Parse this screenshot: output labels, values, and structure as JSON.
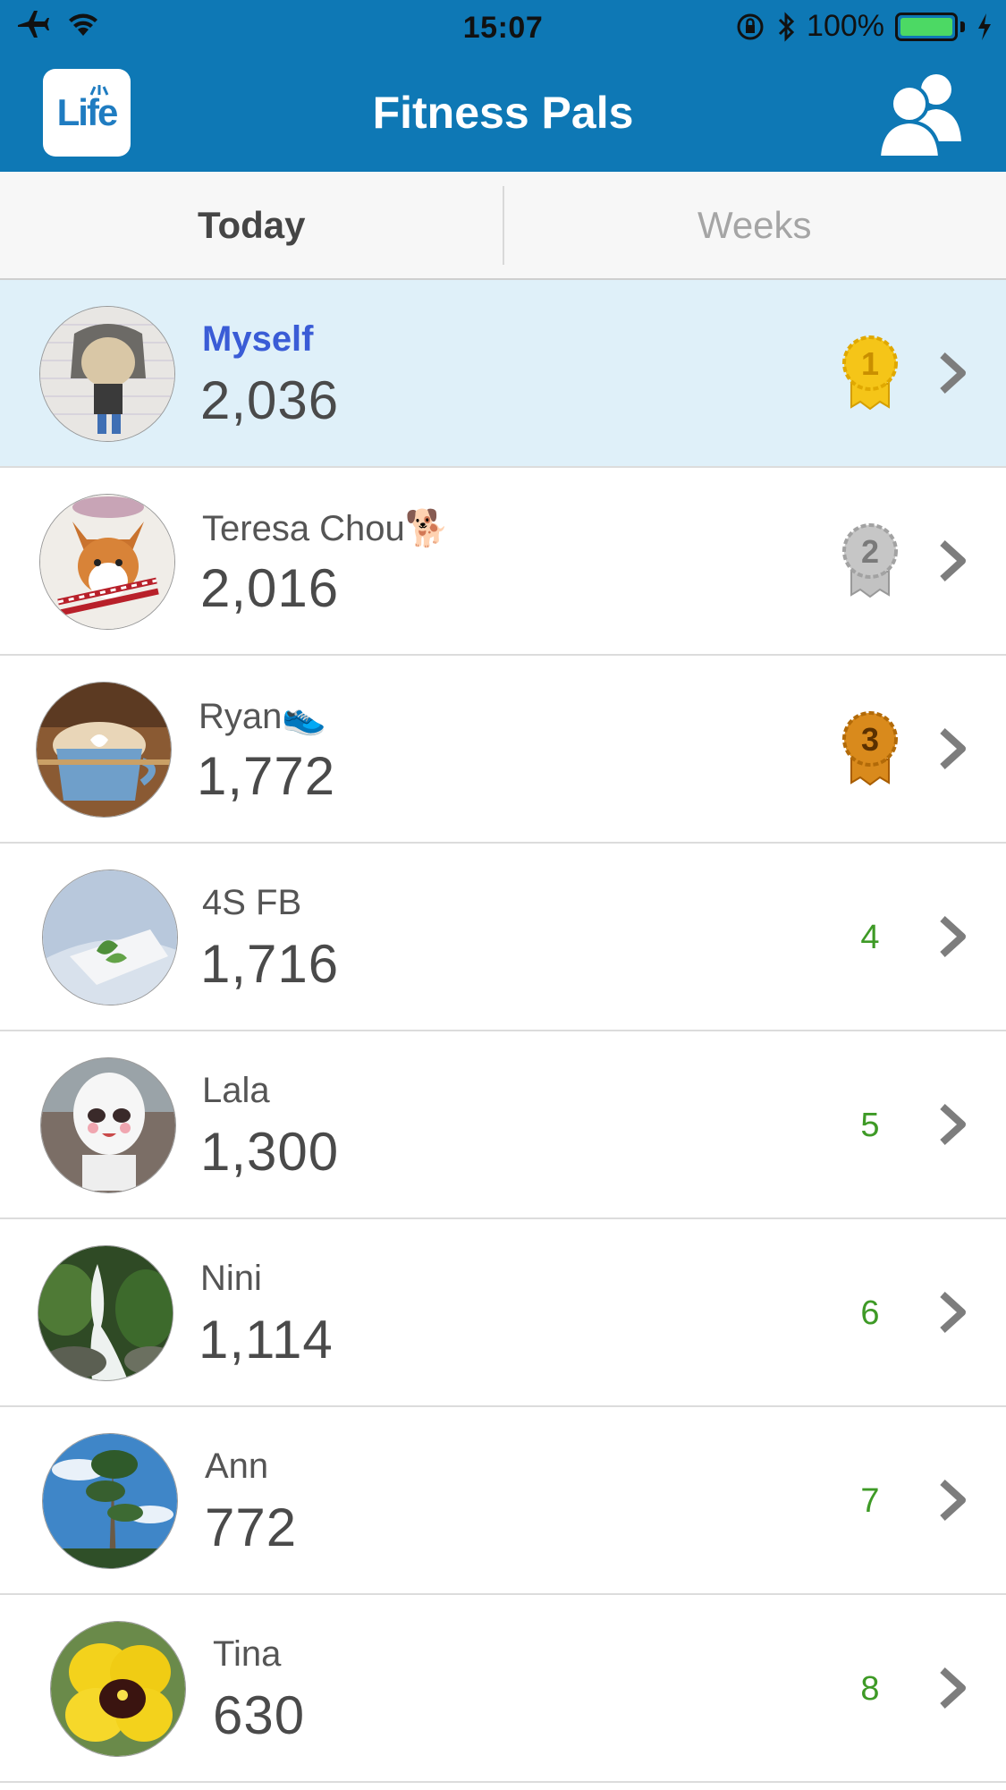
{
  "status_bar": {
    "time": "15:07",
    "battery": "100%"
  },
  "nav": {
    "logo_text": "Life",
    "title": "Fitness Pals"
  },
  "tabs": [
    {
      "label": "Today",
      "active": true
    },
    {
      "label": "Weeks",
      "active": false
    }
  ],
  "pals": [
    {
      "name": "Myself",
      "steps": "2,036",
      "rank": "1",
      "medal": "gold"
    },
    {
      "name": "Teresa Chou🐕",
      "steps": "2,016",
      "rank": "2",
      "medal": "silver"
    },
    {
      "name": "Ryan👟",
      "steps": "1,772",
      "rank": "3",
      "medal": "bronze"
    },
    {
      "name": "4S FB",
      "steps": "1,716",
      "rank": "4"
    },
    {
      "name": "Lala",
      "steps": "1,300",
      "rank": "5"
    },
    {
      "name": "Nini",
      "steps": "1,114",
      "rank": "6"
    },
    {
      "name": "Ann",
      "steps": "772",
      "rank": "7"
    },
    {
      "name": "Tina",
      "steps": "630",
      "rank": "8"
    }
  ],
  "colors": {
    "header": "#0e78b5",
    "self_row": "#dff0f9",
    "self_name": "#3a5cd6",
    "rank_number": "#3e9a26",
    "gold": "#f5c518",
    "silver": "#b5b5b5",
    "bronze": "#d98a1c"
  },
  "icons": [
    "airplane-icon",
    "wifi-icon",
    "orientation-lock-icon",
    "bluetooth-icon",
    "battery-icon",
    "charging-icon",
    "friends-icon",
    "medal-icon",
    "chevron-right-icon"
  ]
}
